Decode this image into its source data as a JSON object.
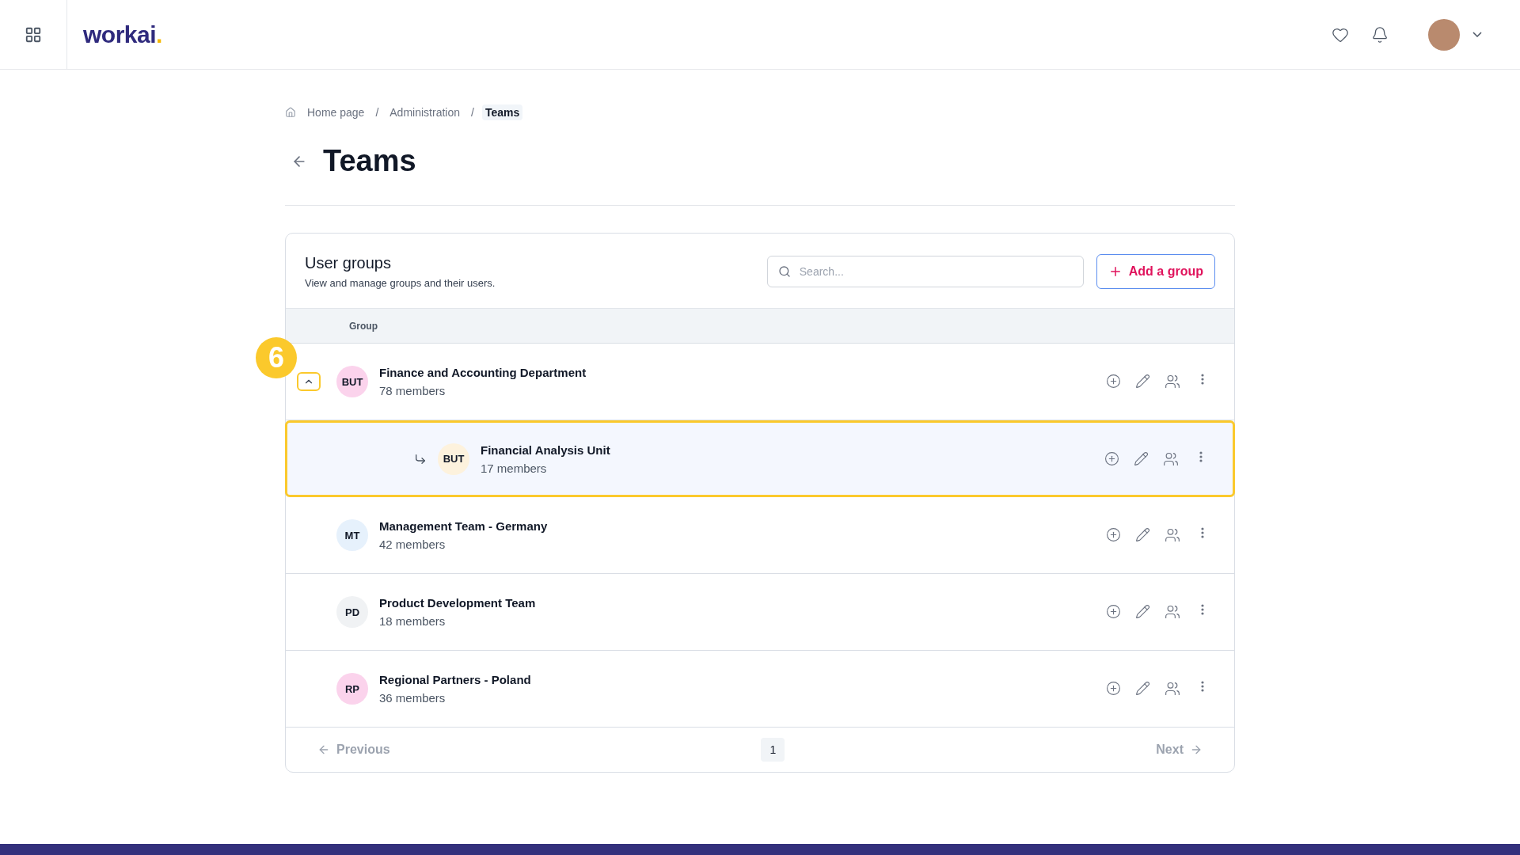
{
  "topbar": {
    "logo": {
      "text": "workai",
      "dot": "."
    }
  },
  "breadcrumb": [
    {
      "label": "Home page",
      "current": false
    },
    {
      "label": "Administration",
      "current": false
    },
    {
      "label": "Teams",
      "current": true
    }
  ],
  "breadcrumb_separator": "/",
  "page_title": "Teams",
  "card": {
    "title": "User groups",
    "subtitle": "View and manage groups and their users.",
    "search": {
      "placeholder": "Search..."
    },
    "add_button": "Add a group"
  },
  "table": {
    "columns": [
      "Group"
    ],
    "rows": [
      {
        "initials": "BUT",
        "name": "Finance and Accounting Department",
        "members": "78 members",
        "color": "#fbd3ec",
        "expanded": true,
        "highlighted": false,
        "callout": "6",
        "children": [
          {
            "initials": "BUT",
            "name": "Financial Analysis Unit",
            "members": "17 members",
            "color": "#fdf2dd",
            "highlighted": true
          }
        ]
      },
      {
        "initials": "MT",
        "name": "Management Team - Germany",
        "members": "42 members",
        "color": "#e6f1fc",
        "highlighted": false
      },
      {
        "initials": "PD",
        "name": "Product Development Team",
        "members": "18 members",
        "color": "#f0f2f4",
        "highlighted": false
      },
      {
        "initials": "RP",
        "name": "Regional Partners - Poland",
        "members": "36 members",
        "color": "#fbd3ec",
        "highlighted": false
      }
    ]
  },
  "pagination": {
    "previous": "Previous",
    "next": "Next",
    "pages": [
      {
        "label": "1",
        "selected": true
      }
    ]
  }
}
